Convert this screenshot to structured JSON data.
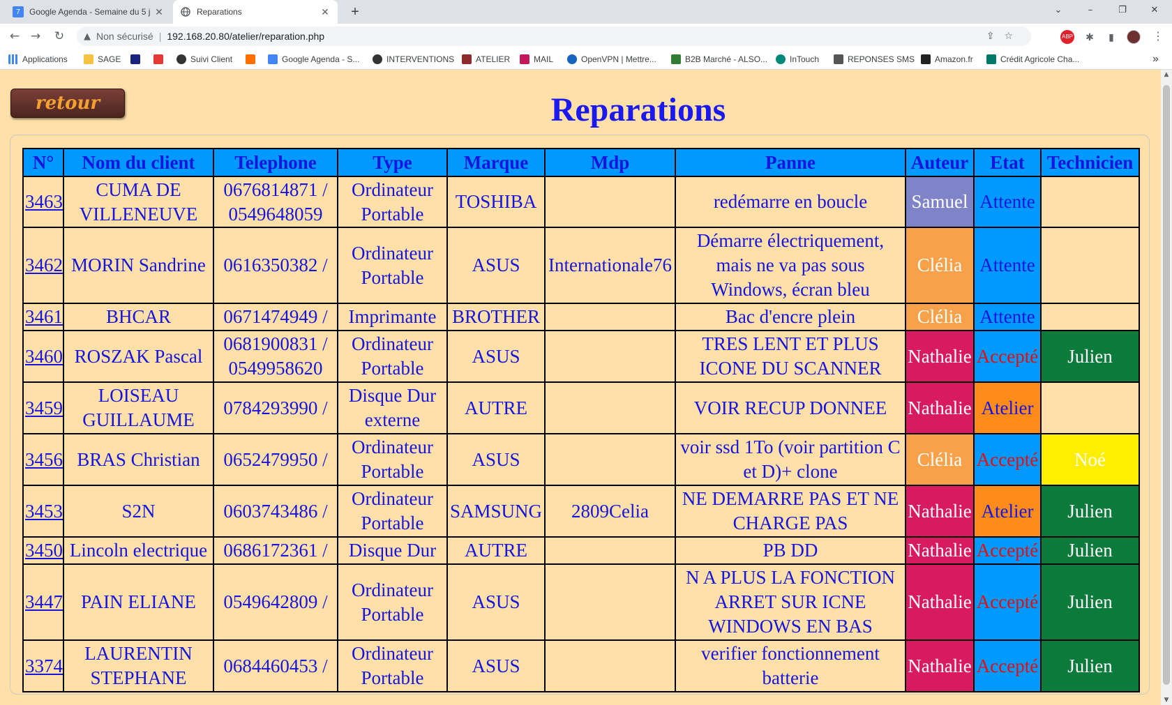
{
  "browser": {
    "tabs": [
      {
        "title": "Google Agenda - Semaine du 5 j",
        "favicon": "7",
        "active": false
      },
      {
        "title": "Reparations",
        "favicon": "globe-icon",
        "active": true
      }
    ],
    "new_tab_label": "+",
    "window_controls": {
      "minimize": "–",
      "restore": "❐",
      "close": "✕",
      "dropdown": "⌄"
    },
    "nav": {
      "back": "←",
      "forward": "→",
      "reload": "↻"
    },
    "address": {
      "security_label": "Non sécurisé",
      "url": "192.168.20.80/atelier/reparation.php",
      "warn_icon": "▲"
    },
    "omnibox_icons": "⇪☆",
    "extensions": [
      {
        "label": "ABP",
        "color": "#e0212b"
      },
      {
        "label": "✱",
        "color": "#5f6368"
      },
      {
        "label": "▮",
        "color": "#5f6368"
      }
    ],
    "menu_label": "⋮",
    "bookmarks": [
      {
        "label": "Applications",
        "color": "#4285f4"
      },
      {
        "label": "SAGE",
        "color": "#f6c343"
      },
      {
        "label": "",
        "color": "#1a237e"
      },
      {
        "label": "",
        "color": "#e53935"
      },
      {
        "label": "Suivi Client",
        "color": "#333333"
      },
      {
        "label": "",
        "color": "#ff6f00"
      },
      {
        "label": "Google Agenda - S...",
        "color": "#4285f4"
      },
      {
        "label": "INTERVENTIONS",
        "color": "#333333"
      },
      {
        "label": "ATELIER",
        "color": "#8d2b2b"
      },
      {
        "label": "MAIL",
        "color": "#c2185b"
      },
      {
        "label": "OpenVPN | Mettre...",
        "color": "#1565c0"
      },
      {
        "label": "B2B Marché - ALSO...",
        "color": "#2e7d32"
      },
      {
        "label": "InTouch",
        "color": "#00897b"
      },
      {
        "label": "REPONSES SMS",
        "color": "#555555"
      },
      {
        "label": "Amazon.fr",
        "color": "#222222"
      },
      {
        "label": "Crédit Agricole Cha...",
        "color": "#00796b"
      }
    ],
    "bookmarks_more": "»"
  },
  "page": {
    "back_button": "retour",
    "title": "Reparations",
    "table": {
      "headers": [
        "N°",
        "Nom du client",
        "Telephone",
        "Type",
        "Marque",
        "Mdp",
        "Panne",
        "Auteur",
        "Etat",
        "Technicien"
      ],
      "rows": [
        {
          "num": "3463",
          "client": "CUMA DE VILLENEUVE",
          "client_red": true,
          "tel": "0676814871 / 0549648059",
          "type": "Ordinateur Portable",
          "marque": "TOSHIBA",
          "mdp": "",
          "panne": "redémarre en boucle",
          "auteur": "Samuel",
          "etat": "Attente",
          "technicien": ""
        },
        {
          "num": "3462",
          "client": "MORIN Sandrine",
          "client_red": false,
          "tel": "0616350382 /",
          "type": "Ordinateur Portable",
          "marque": "ASUS",
          "mdp": "Internationale76",
          "panne": "Démarre électriquement, mais ne va pas sous Windows, écran bleu",
          "auteur": "Clélia",
          "etat": "Attente",
          "technicien": ""
        },
        {
          "num": "3461",
          "client": "BHCAR",
          "client_red": true,
          "tel": "0671474949 /",
          "type": "Imprimante",
          "marque": "BROTHER",
          "mdp": "",
          "panne": "Bac d'encre plein",
          "auteur": "Clélia",
          "etat": "Attente",
          "technicien": ""
        },
        {
          "num": "3460",
          "client": "ROSZAK Pascal",
          "client_red": false,
          "tel": "0681900831 / 0549958620",
          "type": "Ordinateur Portable",
          "marque": "ASUS",
          "mdp": "",
          "panne": "TRES LENT ET PLUS ICONE DU SCANNER",
          "auteur": "Nathalie",
          "etat": "Accepté",
          "technicien": "Julien"
        },
        {
          "num": "3459",
          "client": "LOISEAU GUILLAUME",
          "client_red": false,
          "tel": "0784293990 /",
          "type": "Disque Dur externe",
          "marque": "AUTRE",
          "mdp": "",
          "panne": "VOIR RECUP DONNEE",
          "auteur": "Nathalie",
          "etat": "Atelier",
          "technicien": ""
        },
        {
          "num": "3456",
          "client": "BRAS Christian",
          "client_red": false,
          "tel": "0652479950 /",
          "type": "Ordinateur Portable",
          "marque": "ASUS",
          "mdp": "",
          "panne": "voir ssd 1To (voir partition C et D)+ clone",
          "auteur": "Clélia",
          "etat": "Accepté",
          "technicien": "Noé"
        },
        {
          "num": "3453",
          "client": "S2N",
          "client_red": false,
          "tel": "0603743486 /",
          "type": "Ordinateur Portable",
          "marque": "SAMSUNG",
          "mdp": "2809Celia",
          "panne": "NE DEMARRE PAS ET NE CHARGE PAS",
          "auteur": "Nathalie",
          "etat": "Atelier",
          "technicien": "Julien"
        },
        {
          "num": "3450",
          "client": "Lincoln electrique",
          "client_red": true,
          "tel": "0686172361 /",
          "type": "Disque Dur",
          "marque": "AUTRE",
          "mdp": "",
          "panne": "PB DD",
          "auteur": "Nathalie",
          "etat": "Accepté",
          "technicien": "Julien"
        },
        {
          "num": "3447",
          "client": "PAIN ELIANE",
          "client_red": false,
          "tel": "0549642809 /",
          "type": "Ordinateur Portable",
          "marque": "ASUS",
          "mdp": "",
          "panne": "N A PLUS LA FONCTION ARRET SUR ICNE WINDOWS EN BAS",
          "auteur": "Nathalie",
          "etat": "Accepté",
          "technicien": "Julien"
        },
        {
          "num": "3374",
          "client": "LAURENTIN STEPHANE",
          "client_red": false,
          "tel": "0684460453 /",
          "type": "Ordinateur Portable",
          "marque": "ASUS",
          "mdp": "",
          "panne": "verifier fonctionnement batterie",
          "auteur": "Nathalie",
          "etat": "Accepté",
          "technicien": "Julien"
        }
      ]
    }
  }
}
